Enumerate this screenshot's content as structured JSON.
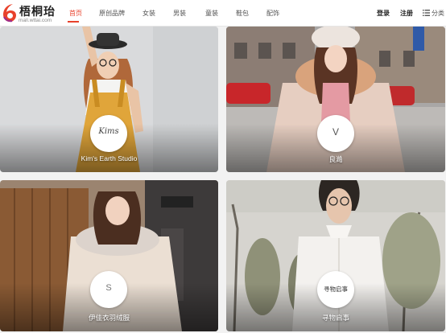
{
  "logo": {
    "name": "梧桐珆",
    "url": "mall.wttai.com",
    "brand_color": "#e8412b"
  },
  "nav": {
    "items": [
      {
        "label": "首页",
        "active": true
      },
      {
        "label": "原创品牌",
        "active": false
      },
      {
        "label": "女装",
        "active": false
      },
      {
        "label": "男装",
        "active": false
      },
      {
        "label": "童装",
        "active": false
      },
      {
        "label": "鞋包",
        "active": false
      },
      {
        "label": "配饰",
        "active": false
      }
    ],
    "active_color": "#e8412b"
  },
  "user": {
    "login_label": "登录",
    "register_label": "注册",
    "categories_label": "分类",
    "categories_icon": "list-icon"
  },
  "brands": [
    {
      "name": "Kim's Earth Studio",
      "logo_text": "Kims"
    },
    {
      "name": "良澔",
      "logo_text": "V"
    },
    {
      "name": "伊佳衣羽绒服",
      "logo_text": "S"
    },
    {
      "name": "寻物启事",
      "logo_text": "寻物启事"
    }
  ]
}
